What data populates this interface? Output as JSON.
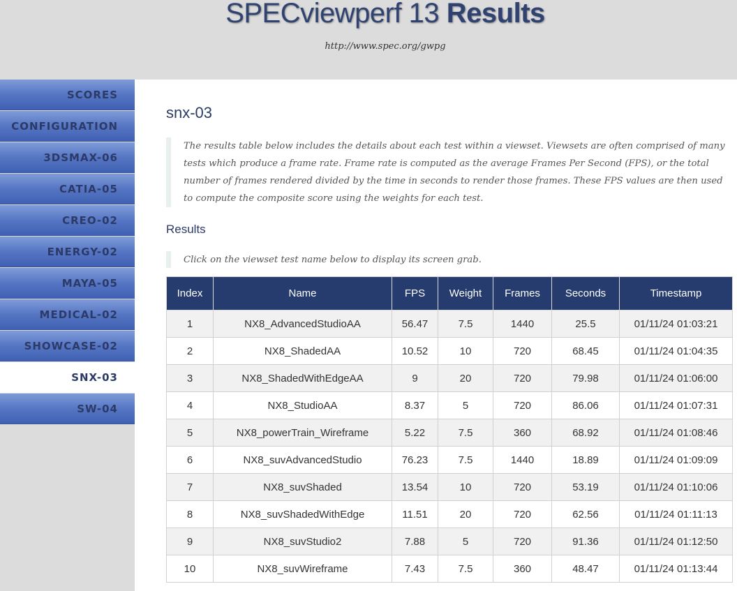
{
  "header": {
    "title_light": "SPECviewperf 13",
    "title_bold": "Results",
    "url": "http://www.spec.org/gwpg"
  },
  "sidebar": {
    "items": [
      {
        "label": "SCORES",
        "active": false
      },
      {
        "label": "CONFIGURATION",
        "active": false
      },
      {
        "label": "3DSMAX-06",
        "active": false
      },
      {
        "label": "CATIA-05",
        "active": false
      },
      {
        "label": "CREO-02",
        "active": false
      },
      {
        "label": "ENERGY-02",
        "active": false
      },
      {
        "label": "MAYA-05",
        "active": false
      },
      {
        "label": "MEDICAL-02",
        "active": false
      },
      {
        "label": "SHOWCASE-02",
        "active": false
      },
      {
        "label": "SNX-03",
        "active": true
      },
      {
        "label": "SW-04",
        "active": false
      }
    ]
  },
  "main": {
    "title": "snx-03",
    "intro": "The results table below includes the details about each test within a viewset. Viewsets are often comprised of many tests which produce a frame rate. Frame rate is computed as the average Frames Per Second (FPS), or the total number of frames rendered divided by the time in seconds to render those frames. These FPS values are then used to compute the composite score using the weights for each test.",
    "results_heading": "Results",
    "hint": "Click on the viewset test name below to display its screen grab.",
    "table": {
      "headers": [
        "Index",
        "Name",
        "FPS",
        "Weight",
        "Frames",
        "Seconds",
        "Timestamp"
      ],
      "rows": [
        [
          "1",
          "NX8_AdvancedStudioAA",
          "56.47",
          "7.5",
          "1440",
          "25.5",
          "01/11/24 01:03:21"
        ],
        [
          "2",
          "NX8_ShadedAA",
          "10.52",
          "10",
          "720",
          "68.45",
          "01/11/24 01:04:35"
        ],
        [
          "3",
          "NX8_ShadedWithEdgeAA",
          "9",
          "20",
          "720",
          "79.98",
          "01/11/24 01:06:00"
        ],
        [
          "4",
          "NX8_StudioAA",
          "8.37",
          "5",
          "720",
          "86.06",
          "01/11/24 01:07:31"
        ],
        [
          "5",
          "NX8_powerTrain_Wireframe",
          "5.22",
          "7.5",
          "360",
          "68.92",
          "01/11/24 01:08:46"
        ],
        [
          "6",
          "NX8_suvAdvancedStudio",
          "76.23",
          "7.5",
          "1440",
          "18.89",
          "01/11/24 01:09:09"
        ],
        [
          "7",
          "NX8_suvShaded",
          "13.54",
          "10",
          "720",
          "53.19",
          "01/11/24 01:10:06"
        ],
        [
          "8",
          "NX8_suvShadedWithEdge",
          "11.51",
          "20",
          "720",
          "62.56",
          "01/11/24 01:11:13"
        ],
        [
          "9",
          "NX8_suvStudio2",
          "7.88",
          "5",
          "720",
          "91.36",
          "01/11/24 01:12:50"
        ],
        [
          "10",
          "NX8_suvWireframe",
          "7.43",
          "7.5",
          "360",
          "48.47",
          "01/11/24 01:13:44"
        ]
      ]
    }
  },
  "colors": {
    "header_bg": "#dcdcdc",
    "title_color": "#2f4270",
    "nav_blue": "#5676c4",
    "table_header_bg": "#273c6e"
  }
}
